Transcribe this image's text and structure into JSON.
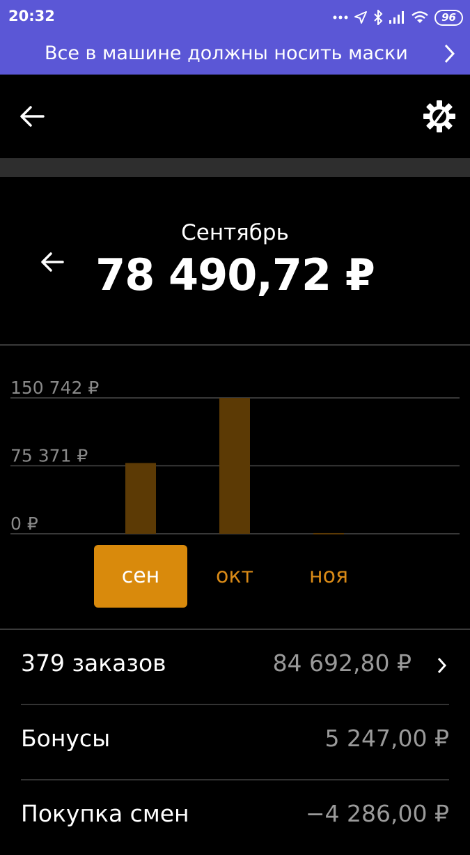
{
  "status": {
    "time": "20:32",
    "battery": "96",
    "icons": [
      "more-dots-icon",
      "location-icon",
      "bluetooth-icon",
      "signal-icon",
      "wifi-icon",
      "battery-icon"
    ]
  },
  "banner": {
    "text": "Все в машине должны носить маски"
  },
  "summary": {
    "month": "Сентябрь",
    "amount": "78 490,72 ₽"
  },
  "chart_data": {
    "type": "bar",
    "categories": [
      "сен",
      "окт",
      "ноя"
    ],
    "values": [
      78490.72,
      150742,
      800
    ],
    "ylim": [
      0,
      150742
    ],
    "yticks": [
      "150 742 ₽",
      "75 371 ₽",
      "0 ₽"
    ],
    "ytick_values": [
      150742,
      75371,
      0
    ],
    "grid": true,
    "bar_color": "#5c3a05",
    "selected": "сен"
  },
  "rows": [
    {
      "label": "379 заказов",
      "value": "84 692,80 ₽",
      "chevron": true
    },
    {
      "label": "Бонусы",
      "value": "5 247,00 ₽",
      "chevron": false
    },
    {
      "label": "Покупка смен",
      "value": "−4 286,00 ₽",
      "chevron": false
    }
  ],
  "colors": {
    "accent": "#d98a0c",
    "status_bar": "#5b57d6",
    "muted_text": "#9a9a9a"
  }
}
